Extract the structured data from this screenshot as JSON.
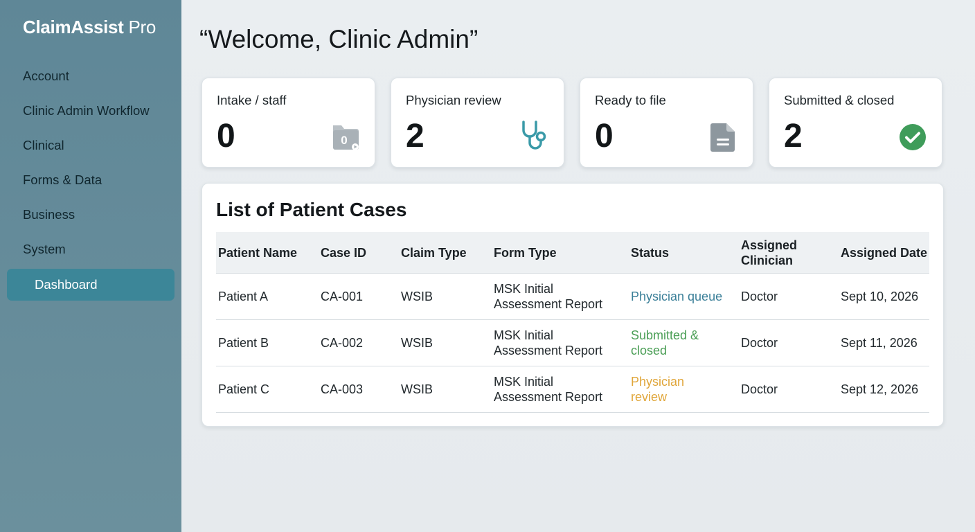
{
  "sidebar": {
    "brand_bold": "ClaimAssist",
    "brand_light": " Pro",
    "items": [
      {
        "label": "Account"
      },
      {
        "label": "Clinic Admin Workflow"
      },
      {
        "label": "Clinical"
      },
      {
        "label": "Forms & Data"
      },
      {
        "label": "Business"
      },
      {
        "label": "System"
      },
      {
        "label": "Dashboard",
        "active": true
      }
    ]
  },
  "main": {
    "welcome": "“Welcome, Clinic Admin”",
    "cards": [
      {
        "label": "Intake / staff",
        "value": "0",
        "icon": "folder-icon",
        "icon_text": "0"
      },
      {
        "label": "Physician review",
        "value": "2",
        "icon": "stethoscope-icon"
      },
      {
        "label": "Ready to file",
        "value": "0",
        "icon": "document-icon"
      },
      {
        "label": "Submitted & closed",
        "value": "2",
        "icon": "check-circle-icon"
      }
    ],
    "table": {
      "title": "List of Patient Cases",
      "headers": [
        "Patient Name",
        "Case ID",
        "Claim Type",
        "Form Type",
        "Status",
        "Assigned Clinician",
        "Assigned Date"
      ],
      "rows": [
        {
          "patient": "Patient A",
          "case_id": "CA-001",
          "claim": "WSIB",
          "form": "MSK Initial Assessment Report",
          "status": "Physician queue",
          "clinician": "Doctor",
          "date": "Sept 10, 2026"
        },
        {
          "patient": "Patient B",
          "case_id": "CA-002",
          "claim": "WSIB",
          "form": "MSK Initial Assessment Report",
          "status": "Submitted & closed",
          "clinician": "Doctor",
          "date": "Sept 11, 2026"
        },
        {
          "patient": "Patient C",
          "case_id": "CA-003",
          "claim": "WSIB",
          "form": "MSK Initial Assessment Report",
          "status": "Physician review",
          "clinician": "Doctor",
          "date": "Sept 12, 2026"
        }
      ]
    }
  },
  "colors": {
    "sidebar": "#5f8797",
    "active_nav": "#3c8698",
    "status_queue": "#3a7f98",
    "status_closed": "#4a9e55",
    "status_review": "#e0a63a",
    "stethoscope": "#3a9aa8",
    "check": "#3f9c5a"
  }
}
